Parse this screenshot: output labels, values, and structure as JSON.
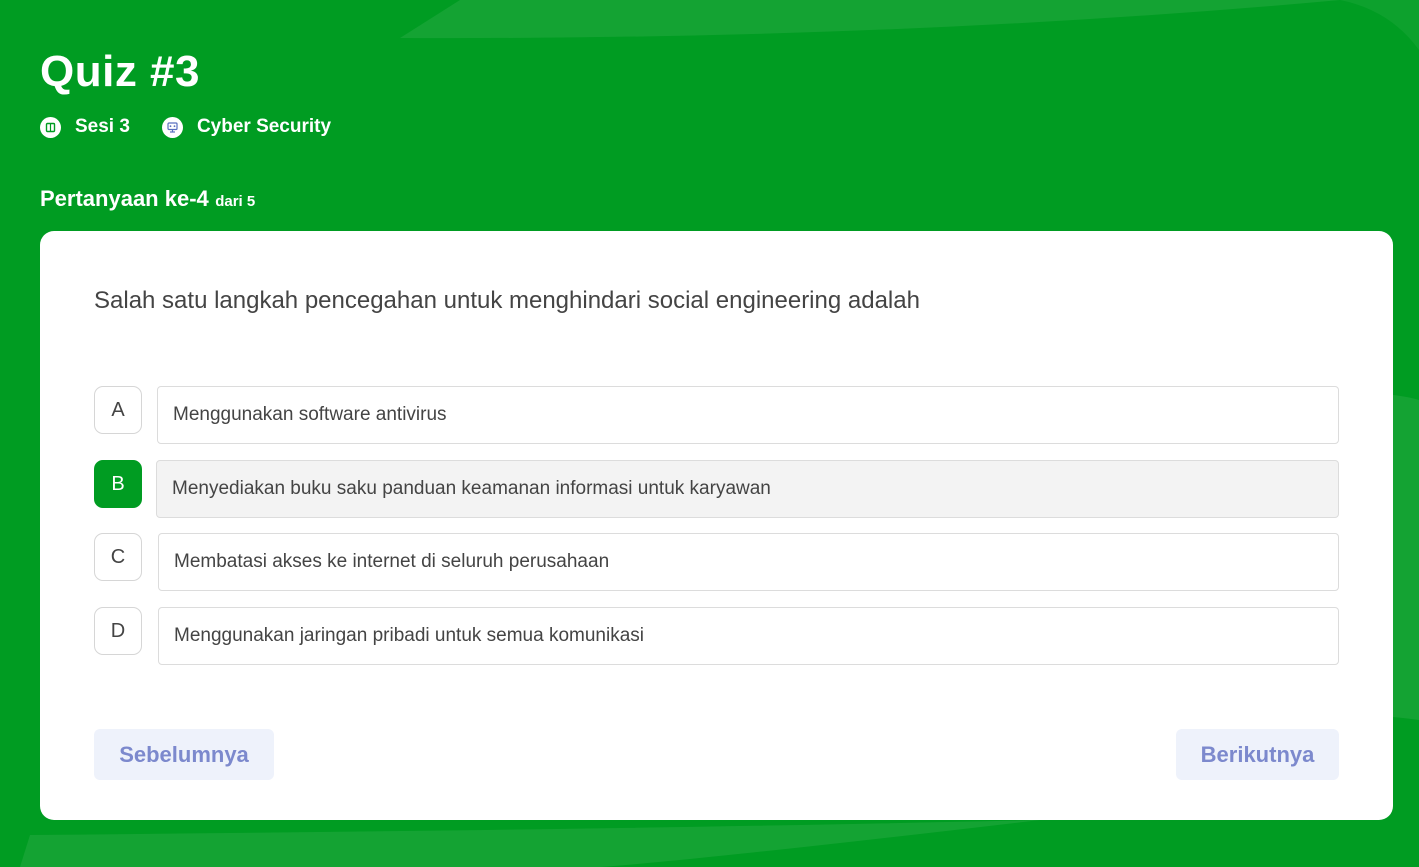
{
  "quiz": {
    "title": "Quiz #3",
    "session": "Sesi 3",
    "topic": "Cyber Security"
  },
  "progress": {
    "label": "Pertanyaan ke-4",
    "total_label": "dari 5"
  },
  "question": {
    "text": "Salah satu langkah pencegahan untuk menghindari social engineering adalah",
    "options": [
      {
        "letter": "A",
        "text": "Menggunakan software antivirus",
        "selected": false
      },
      {
        "letter": "B",
        "text": "Menyediakan buku saku panduan keamanan informasi untuk karyawan",
        "selected": true
      },
      {
        "letter": "C",
        "text": "Membatasi akses ke internet di seluruh perusahaan",
        "selected": false
      },
      {
        "letter": "D",
        "text": "Menggunakan jaringan pribadi untuk semua komunikasi",
        "selected": false
      }
    ]
  },
  "navigation": {
    "prev_label": "Sebelumnya",
    "next_label": "Berikutnya"
  },
  "colors": {
    "background": "#009c22",
    "accent": "#009c22",
    "button_text": "#7c89cd",
    "button_bg": "#eef2fb"
  },
  "icons": {
    "session": "book-icon",
    "topic": "computer-icon"
  }
}
